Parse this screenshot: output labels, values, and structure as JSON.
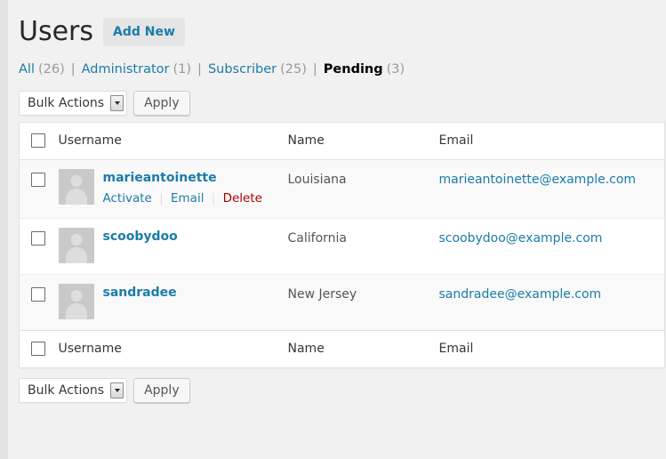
{
  "header": {
    "title": "Users",
    "add_new_label": "Add New"
  },
  "filters": [
    {
      "label": "All",
      "count": "(26)",
      "current": false
    },
    {
      "label": "Administrator",
      "count": "(1)",
      "current": false
    },
    {
      "label": "Subscriber",
      "count": "(25)",
      "current": false
    },
    {
      "label": "Pending",
      "count": "(3)",
      "current": true
    }
  ],
  "separator": "|",
  "tablenav": {
    "bulk_actions_label": "Bulk Actions",
    "apply_label": "Apply"
  },
  "table": {
    "columns": {
      "username": "Username",
      "name": "Name",
      "email": "Email"
    },
    "rows": [
      {
        "username": "marieantoinette",
        "name": "Louisiana",
        "email": "marieantoinette@example.com",
        "actions": [
          {
            "label": "Activate",
            "kind": "activate"
          },
          {
            "label": "Email",
            "kind": "email"
          },
          {
            "label": "Delete",
            "kind": "delete"
          }
        ]
      },
      {
        "username": "scoobydoo",
        "name": "California",
        "email": "scoobydoo@example.com",
        "actions": []
      },
      {
        "username": "sandradee",
        "name": "New Jersey",
        "email": "sandradee@example.com",
        "actions": []
      }
    ]
  },
  "colors": {
    "link": "#1b7ca8",
    "delete": "#a00",
    "page_bg": "#f1f1f1",
    "row_alt": "#f9f9f9",
    "avatar": "#c9c9c9"
  }
}
